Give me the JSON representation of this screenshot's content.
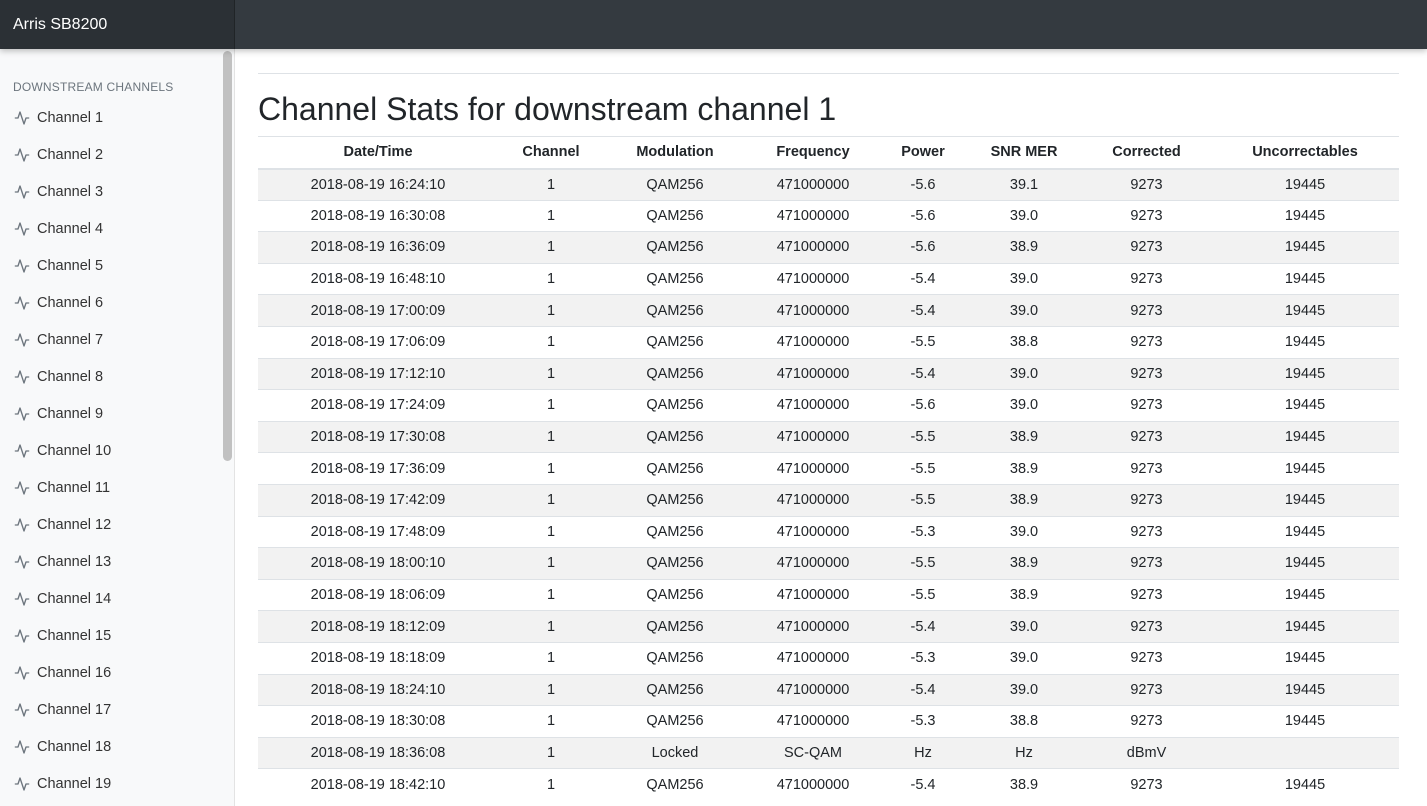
{
  "app": {
    "brand": "Arris SB8200"
  },
  "sidebar": {
    "heading": "DOWNSTREAM CHANNELS",
    "items": [
      "Channel 1",
      "Channel 2",
      "Channel 3",
      "Channel 4",
      "Channel 5",
      "Channel 6",
      "Channel 7",
      "Channel 8",
      "Channel 9",
      "Channel 10",
      "Channel 11",
      "Channel 12",
      "Channel 13",
      "Channel 14",
      "Channel 15",
      "Channel 16",
      "Channel 17",
      "Channel 18",
      "Channel 19"
    ],
    "item_icon": "activity-icon"
  },
  "main": {
    "title": "Channel Stats for downstream channel 1",
    "columns": [
      "Date/Time",
      "Channel",
      "Modulation",
      "Frequency",
      "Power",
      "SNR MER",
      "Corrected",
      "Uncorrectables"
    ],
    "rows": [
      [
        "2018-08-19 16:24:10",
        "1",
        "QAM256",
        "471000000",
        "-5.6",
        "39.1",
        "9273",
        "19445"
      ],
      [
        "2018-08-19 16:30:08",
        "1",
        "QAM256",
        "471000000",
        "-5.6",
        "39.0",
        "9273",
        "19445"
      ],
      [
        "2018-08-19 16:36:09",
        "1",
        "QAM256",
        "471000000",
        "-5.6",
        "38.9",
        "9273",
        "19445"
      ],
      [
        "2018-08-19 16:48:10",
        "1",
        "QAM256",
        "471000000",
        "-5.4",
        "39.0",
        "9273",
        "19445"
      ],
      [
        "2018-08-19 17:00:09",
        "1",
        "QAM256",
        "471000000",
        "-5.4",
        "39.0",
        "9273",
        "19445"
      ],
      [
        "2018-08-19 17:06:09",
        "1",
        "QAM256",
        "471000000",
        "-5.5",
        "38.8",
        "9273",
        "19445"
      ],
      [
        "2018-08-19 17:12:10",
        "1",
        "QAM256",
        "471000000",
        "-5.4",
        "39.0",
        "9273",
        "19445"
      ],
      [
        "2018-08-19 17:24:09",
        "1",
        "QAM256",
        "471000000",
        "-5.6",
        "39.0",
        "9273",
        "19445"
      ],
      [
        "2018-08-19 17:30:08",
        "1",
        "QAM256",
        "471000000",
        "-5.5",
        "38.9",
        "9273",
        "19445"
      ],
      [
        "2018-08-19 17:36:09",
        "1",
        "QAM256",
        "471000000",
        "-5.5",
        "38.9",
        "9273",
        "19445"
      ],
      [
        "2018-08-19 17:42:09",
        "1",
        "QAM256",
        "471000000",
        "-5.5",
        "38.9",
        "9273",
        "19445"
      ],
      [
        "2018-08-19 17:48:09",
        "1",
        "QAM256",
        "471000000",
        "-5.3",
        "39.0",
        "9273",
        "19445"
      ],
      [
        "2018-08-19 18:00:10",
        "1",
        "QAM256",
        "471000000",
        "-5.5",
        "38.9",
        "9273",
        "19445"
      ],
      [
        "2018-08-19 18:06:09",
        "1",
        "QAM256",
        "471000000",
        "-5.5",
        "38.9",
        "9273",
        "19445"
      ],
      [
        "2018-08-19 18:12:09",
        "1",
        "QAM256",
        "471000000",
        "-5.4",
        "39.0",
        "9273",
        "19445"
      ],
      [
        "2018-08-19 18:18:09",
        "1",
        "QAM256",
        "471000000",
        "-5.3",
        "39.0",
        "9273",
        "19445"
      ],
      [
        "2018-08-19 18:24:10",
        "1",
        "QAM256",
        "471000000",
        "-5.4",
        "39.0",
        "9273",
        "19445"
      ],
      [
        "2018-08-19 18:30:08",
        "1",
        "QAM256",
        "471000000",
        "-5.3",
        "38.8",
        "9273",
        "19445"
      ],
      [
        "2018-08-19 18:36:08",
        "1",
        "Locked",
        "SC-QAM",
        "Hz",
        "Hz",
        "dBmV",
        ""
      ],
      [
        "2018-08-19 18:42:10",
        "1",
        "QAM256",
        "471000000",
        "-5.4",
        "38.9",
        "9273",
        "19445"
      ]
    ]
  },
  "colors": {
    "topbar": "#343a40",
    "brand_bg": "#2b3035",
    "sidebar_bg": "#f8f9fa",
    "stripe": "#f2f2f2"
  }
}
